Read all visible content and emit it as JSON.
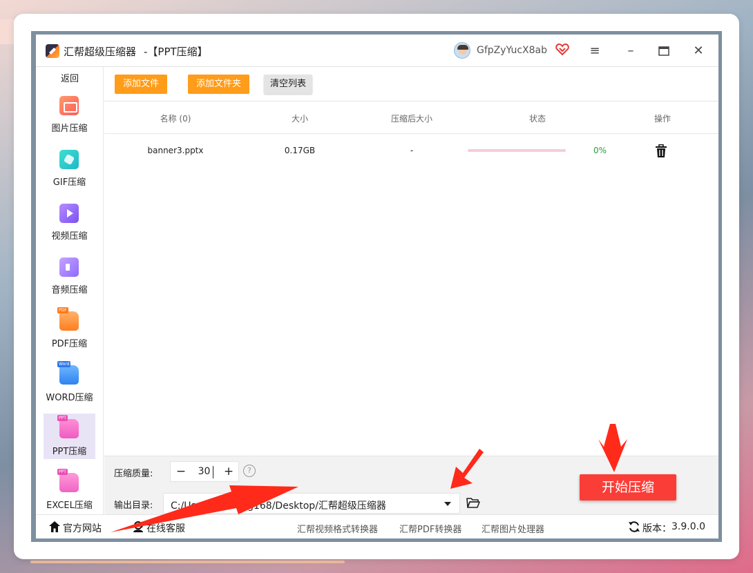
{
  "window": {
    "app_title": "汇帮超级压缩器",
    "subtitle": "-【PPT压缩】",
    "username": "GfpZyYucX8ab"
  },
  "sidebar": {
    "back": "返回",
    "items": [
      {
        "label": "图片压缩"
      },
      {
        "label": "GIF压缩"
      },
      {
        "label": "视频压缩"
      },
      {
        "label": "音频压缩"
      },
      {
        "label": "PDF压缩",
        "tag": "PDF"
      },
      {
        "label": "WORD压缩",
        "tag": "Word"
      },
      {
        "label": "PPT压缩",
        "tag": "PPT",
        "active": true
      },
      {
        "label": "EXCEL压缩",
        "tag": "PPT"
      }
    ]
  },
  "toolbar": {
    "add_file": "添加文件",
    "add_folder": "添加文件夹",
    "clear_list": "清空列表"
  },
  "table": {
    "columns": [
      "名称 (0)",
      "大小",
      "压缩后大小",
      "状态",
      "操作"
    ],
    "rows": [
      {
        "name": "banner3.pptx",
        "size": "0.17GB",
        "compressed_size": "-",
        "progress": 0,
        "percent": "0%"
      }
    ]
  },
  "settings": {
    "quality_label": "压缩质量:",
    "quality_value": "30",
    "minus": "−",
    "plus": "+",
    "help": "?",
    "output_label": "输出目录:",
    "output_path": "C:/Users/huibang168/Desktop/汇帮超级压缩器"
  },
  "actions": {
    "start": "开始压缩"
  },
  "statusbar": {
    "website": "官方网站",
    "support": "在线客服",
    "link1": "汇帮视频格式转换器",
    "link2": "汇帮PDF转换器",
    "link3": "汇帮图片处理器",
    "version_label": "版本：",
    "version": "3.9.0.0"
  },
  "colors": {
    "accent_orange": "#ff9c1a",
    "start_red": "#fb3d38",
    "annotation_red": "#ff2a1a",
    "progress_track": "#f7cdd7",
    "percent_green": "#2e9d3a"
  },
  "icons": [
    "menu-icon",
    "minimize-icon",
    "maximize-icon",
    "close-icon",
    "vip-heart-icon",
    "trash-icon",
    "help-icon",
    "folder-icon",
    "home-icon",
    "support-icon",
    "refresh-icon",
    "dropdown-caret-icon"
  ]
}
